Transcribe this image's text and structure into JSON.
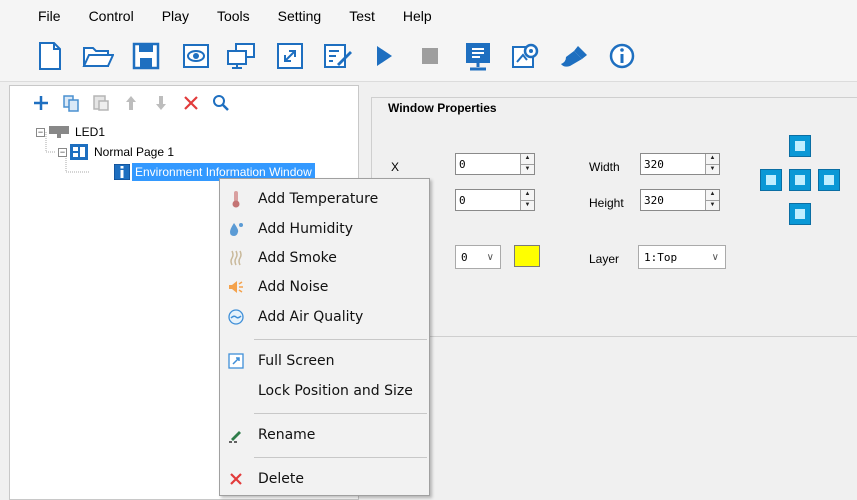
{
  "menubar": {
    "items": [
      "File",
      "Control",
      "Play",
      "Tools",
      "Setting",
      "Test",
      "Help"
    ]
  },
  "toolbar": {
    "icons": [
      "new-file-icon",
      "open-folder-icon",
      "save-icon",
      "preview-eye-icon",
      "network-icon",
      "fullscreen-icon",
      "edit-icon",
      "play-icon",
      "stop-icon",
      "display-icon",
      "settings-icon",
      "brush-icon",
      "info-icon"
    ],
    "accent": "#0a73c8"
  },
  "left_toolbar": {
    "icons": [
      "add-icon",
      "copy-icon",
      "paste-icon",
      "move-up-icon",
      "move-down-icon",
      "delete-icon",
      "search-icon"
    ]
  },
  "tree": {
    "led": "LED1",
    "page": "Normal Page 1",
    "window": "Environment Information Window"
  },
  "properties": {
    "title": "Window Properties",
    "x_label": "X",
    "x_value": "0",
    "y_value": "0",
    "width_label": "Width",
    "width_value": "320",
    "height_label": "Height",
    "height_value": "320",
    "combo_value": "0",
    "color": "#ffff00",
    "layer_label": "Layer",
    "layer_value": "1:Top"
  },
  "context_menu": {
    "add_temperature": "Add Temperature",
    "add_humidity": "Add Humidity",
    "add_smoke": "Add Smoke",
    "add_noise": "Add Noise",
    "add_air_quality": "Add Air Quality",
    "full_screen": "Full Screen",
    "lock_position": "Lock Position and Size",
    "rename": "Rename",
    "delete": "Delete"
  }
}
